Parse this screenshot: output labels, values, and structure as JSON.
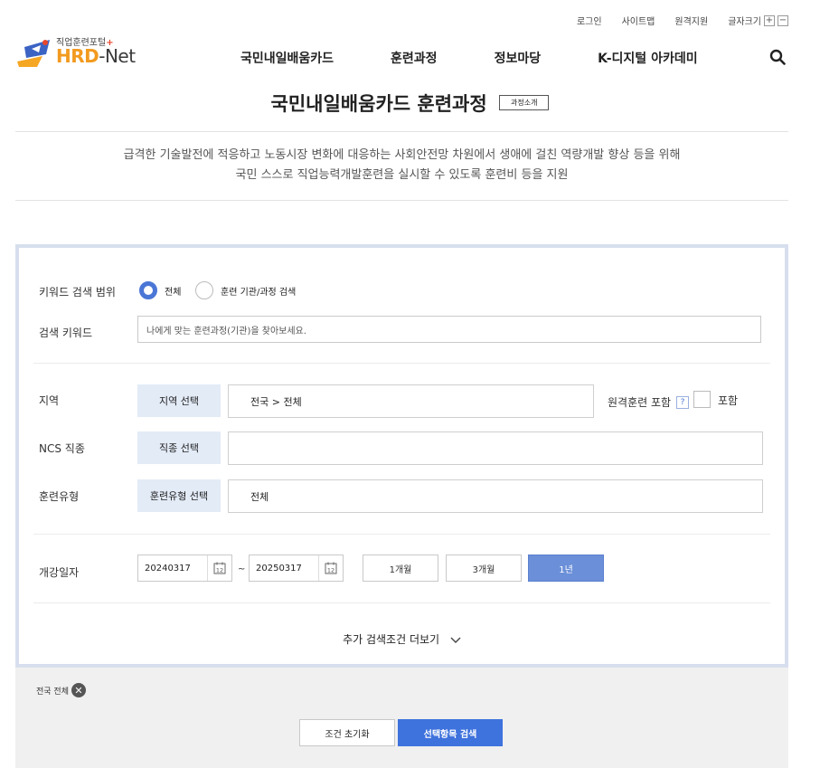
{
  "util": {
    "login": "로그인",
    "sitemap": "사이트맵",
    "remote": "원격지원",
    "font_size": "글자크기",
    "plus": "+",
    "minus": "−"
  },
  "logo": {
    "sub": "직업훈련포털",
    "plus": "+",
    "hrd": "HRD",
    "dash": "-",
    "net": "Net"
  },
  "gnb": [
    "국민내일배움카드",
    "훈련과정",
    "정보마당",
    "K-디지털 아카데미"
  ],
  "page": {
    "title": "국민내일배움카드 훈련과정",
    "intro_label": "과정소개",
    "desc_line1": "급격한 기술발전에 적응하고 노동시장 변화에 대응하는 사회안전망 차원에서 생애에 걸친 역량개발 향상 등을 위해",
    "desc_line2": "국민 스스로 직업능력개발훈련을 실시할 수 있도록 훈련비 등을 지원"
  },
  "form": {
    "keyword_scope_label": "키워드 검색 범위",
    "scope_all": "전체",
    "scope_org": "훈련 기관/과정 검색",
    "keyword_label": "검색 키워드",
    "keyword_placeholder": "나에게 맞는 훈련과정(기관)을 찾아보세요.",
    "region_label": "지역",
    "region_btn": "지역 선택",
    "region_value": "전국 > 전체",
    "remote_label": "원격훈련 포함",
    "qmark": "?",
    "include_label": "포함",
    "ncs_label": "NCS 직종",
    "ncs_btn": "직종 선택",
    "ncs_value": "",
    "type_label": "훈련유형",
    "type_btn": "훈련유형 선택",
    "type_value": "전체",
    "date_label": "개강일자",
    "date_from": "20240317",
    "date_tilde": "~",
    "date_to": "20250317",
    "cal_num": "12",
    "periods": [
      "1개월",
      "3개월",
      "1년"
    ],
    "more_label": "추가 검색조건 더보기"
  },
  "bottom": {
    "chip": "전국 전체",
    "chip_x": "✕",
    "reset": "조건 초기화",
    "search": "선택항목 검색"
  },
  "colors": {
    "accent": "#3e72dd",
    "panel_border": "#d7dfee",
    "select_btn_bg": "#e3ebf7"
  }
}
